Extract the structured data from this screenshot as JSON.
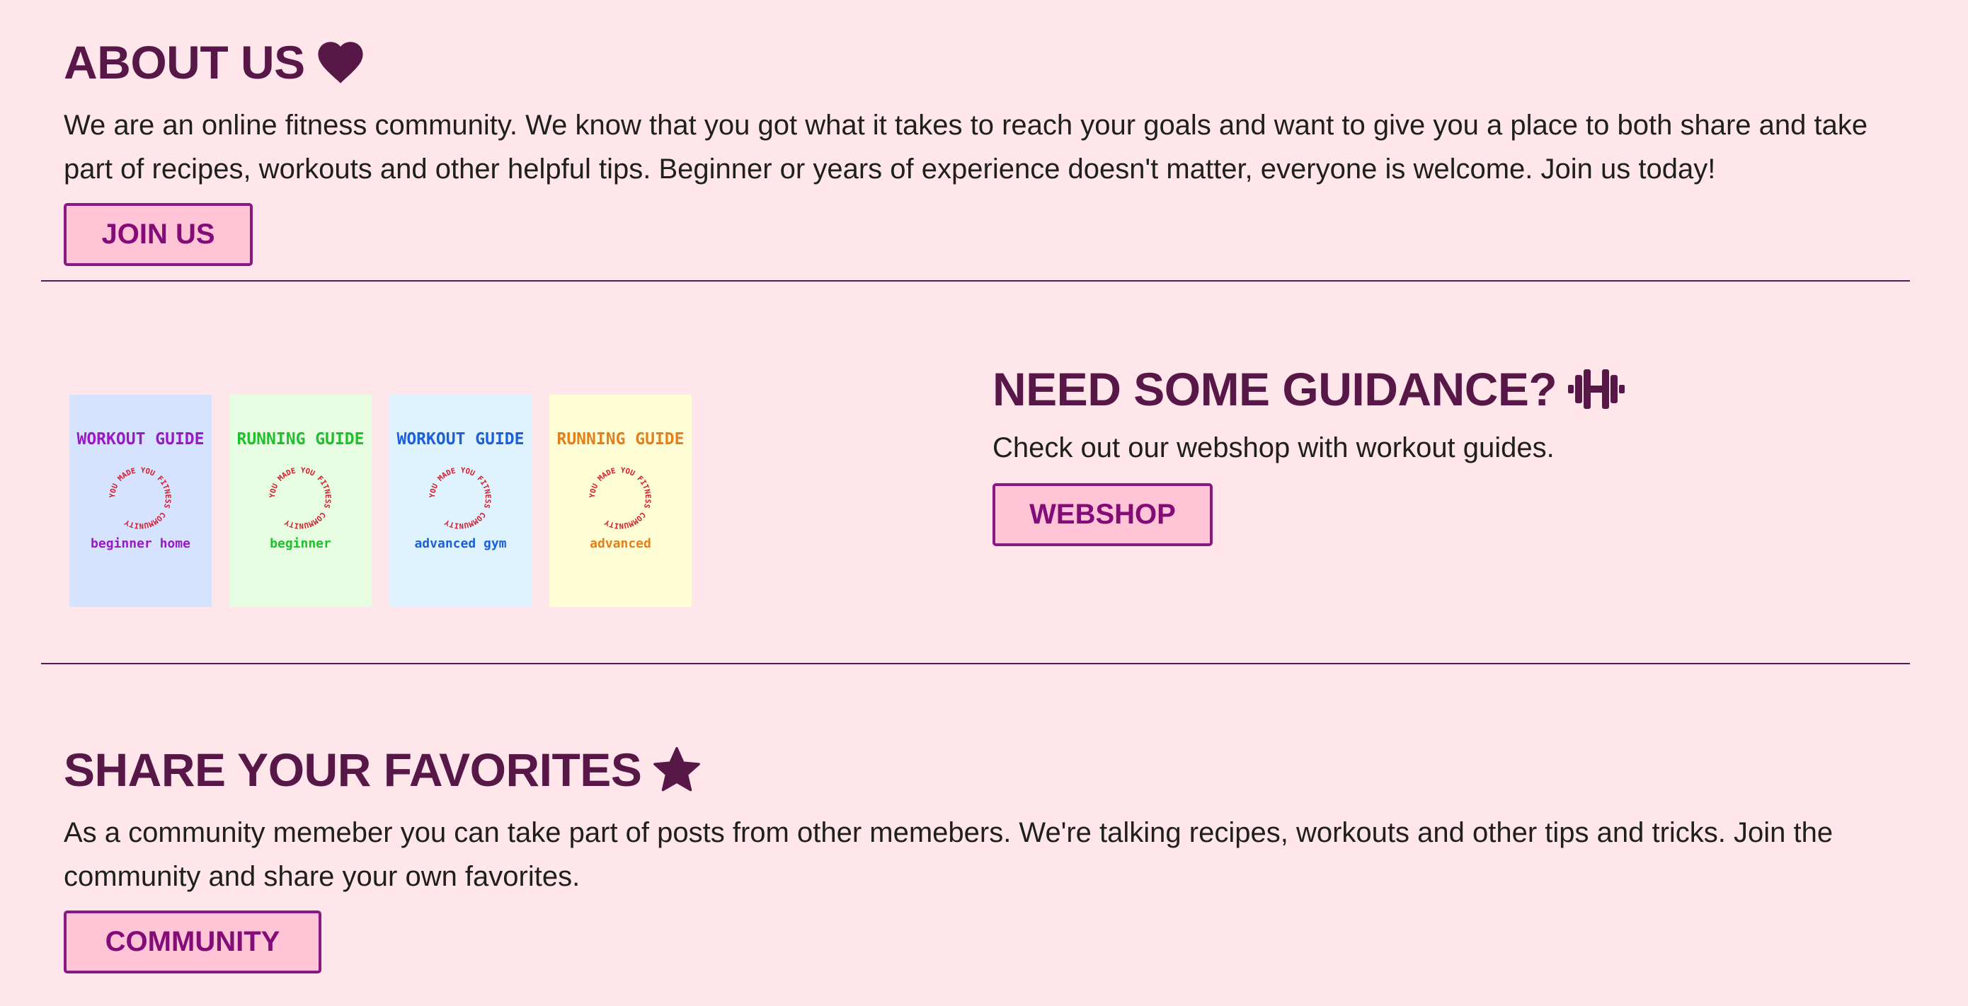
{
  "about": {
    "title": "ABOUT US",
    "icon": "heart-icon",
    "text": "We are an online fitness community. We know that you got what it takes to reach your goals and want to give you a place to both share and take part of recipes, workouts and other helpful tips. Beginner or years of experience doesn't matter, everyone is welcome. Join us today!",
    "button_label": "JOIN US"
  },
  "guidance": {
    "title": "NEED SOME GUIDANCE?",
    "icon": "dumbbell-icon",
    "text": "Check out our webshop with workout guides.",
    "button_label": "WEBSHOP",
    "guides": [
      {
        "title": "WORKOUT GUIDE",
        "subtitle": "beginner home",
        "bg": "#d6e3ff",
        "color": "#9a18c8"
      },
      {
        "title": "RUNNING GUIDE",
        "subtitle": "beginner",
        "bg": "#e6fde2",
        "color": "#1ec12c"
      },
      {
        "title": "WORKOUT GUIDE",
        "subtitle": "advanced gym",
        "bg": "#dff3ff",
        "color": "#1b5fdc"
      },
      {
        "title": "RUNNING GUIDE",
        "subtitle": "advanced",
        "bg": "#fffdd6",
        "color": "#e47f1a"
      }
    ],
    "seal_text": "YOU MADE YOU FITNESS COMMUNITY",
    "seal_color": "#d41c2c"
  },
  "favorites": {
    "title": "SHARE YOUR FAVORITES",
    "icon": "star-icon",
    "text": "As a community memeber you can take part of posts from other memebers. We're talking recipes, workouts and other tips and tricks. Join the community and share your own favorites.",
    "button_label": "COMMUNITY"
  },
  "colors": {
    "background": "#ffe6ea",
    "heading": "#571848",
    "button_bg": "#ffc4d6",
    "button_border": "#8a1883",
    "button_text": "#830c78"
  }
}
